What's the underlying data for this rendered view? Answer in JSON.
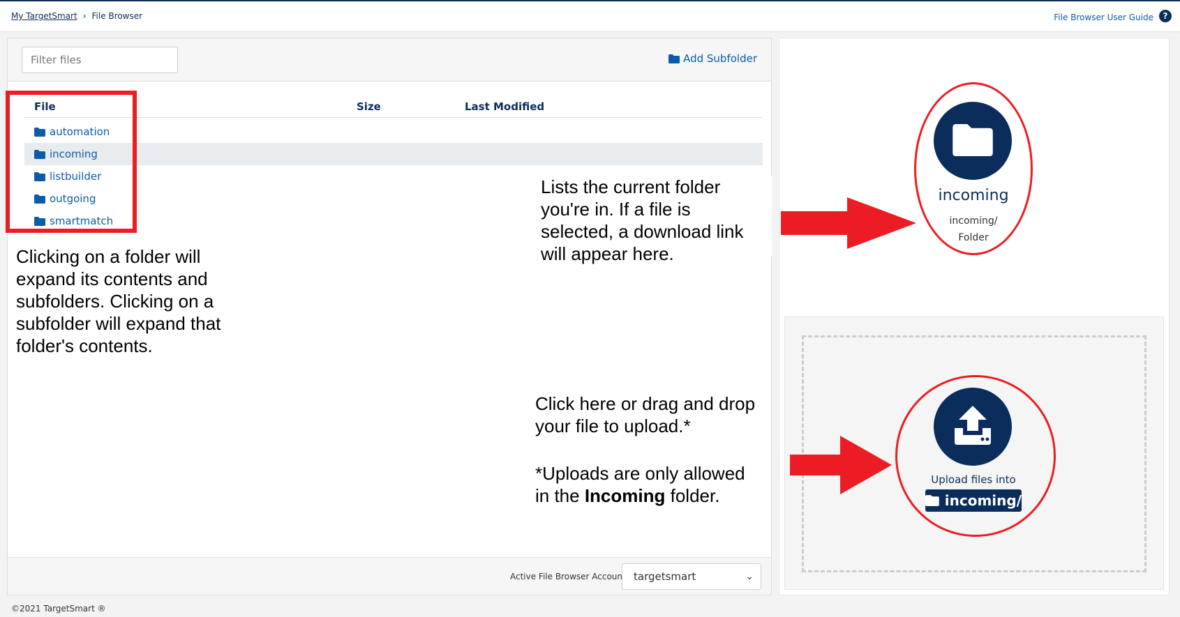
{
  "breadcrumb": {
    "home": "My TargetSmart",
    "separator": "›",
    "current": "File Browser"
  },
  "header": {
    "guide_link": "File Browser User Guide",
    "help_icon": "question-circle-icon",
    "help_glyph": "?"
  },
  "toolbar": {
    "filter_placeholder": "Filter files",
    "add_subfolder": "Add Subfolder"
  },
  "table": {
    "columns": [
      "File",
      "Size",
      "Last Modified"
    ],
    "rows": [
      {
        "name": "automation",
        "selected": false
      },
      {
        "name": "incoming",
        "selected": true
      },
      {
        "name": "listbuilder",
        "selected": false
      },
      {
        "name": "outgoing",
        "selected": false
      },
      {
        "name": "smartmatch",
        "selected": false
      }
    ]
  },
  "footer": {
    "account_label": "Active File Browser Account:",
    "account_value": "targetsmart",
    "copyright": "©2021 TargetSmart ®"
  },
  "current_folder": {
    "name": "incoming",
    "path": "incoming/",
    "type": "Folder"
  },
  "upload": {
    "label": "Upload files into",
    "target": "incoming/"
  },
  "annotations": {
    "left_1": "Clicking on a folder will",
    "left_2": "expand its contents and",
    "left_3": "subfolders. Clicking on a",
    "left_4": "subfolder will expand that",
    "left_5": "folder's contents.",
    "mid_1": "Lists the current folder",
    "mid_2": "you're in. If a file is",
    "mid_3": "selected, a download link",
    "mid_4": "will appear here.",
    "up_1": "Click here or drag and drop",
    "up_2": "your file to upload.*",
    "note_1": "*Uploads are only allowed",
    "note_2a": "in the ",
    "note_2b": "Incoming",
    "note_2c": " folder."
  },
  "colors": {
    "navy": "#0b2d5b",
    "link": "#0b5ca8",
    "annotation_red": "#ec1c24"
  }
}
